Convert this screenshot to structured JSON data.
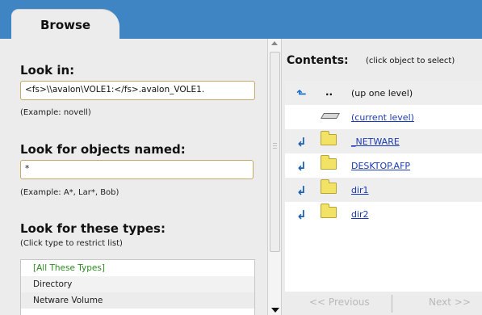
{
  "tab": {
    "label": "Browse"
  },
  "left": {
    "look_in": {
      "label": "Look in:",
      "value": "<fs>\\\\avalon\\VOLE1:</fs>.avalon_VOLE1.",
      "example": "(Example: novell)"
    },
    "look_for": {
      "label": "Look for objects named:",
      "value": "*",
      "example": "(Example: A*, Lar*, Bob)"
    },
    "types": {
      "label": "Look for these types:",
      "hint": "(Click type to restrict list)",
      "items": [
        "[All These Types]",
        "Directory",
        "Netware Volume"
      ]
    }
  },
  "contents": {
    "title": "Contents:",
    "hint": "(click object to select)",
    "rows": [
      {
        "icon": "up-level-icon",
        "dots": "..",
        "label": "(up one level)",
        "is_link": false
      },
      {
        "icon": "volume-icon",
        "label": "(current level)",
        "is_link": true
      },
      {
        "icon": "folder-icon",
        "label": "_NETWARE",
        "is_link": true
      },
      {
        "icon": "folder-icon",
        "label": "DESKTOP.AFP",
        "is_link": true
      },
      {
        "icon": "folder-icon",
        "label": "dir1",
        "is_link": true
      },
      {
        "icon": "folder-icon",
        "label": "dir2",
        "is_link": true
      }
    ],
    "prev_label": "<< Previous",
    "next_label": "Next >>"
  }
}
